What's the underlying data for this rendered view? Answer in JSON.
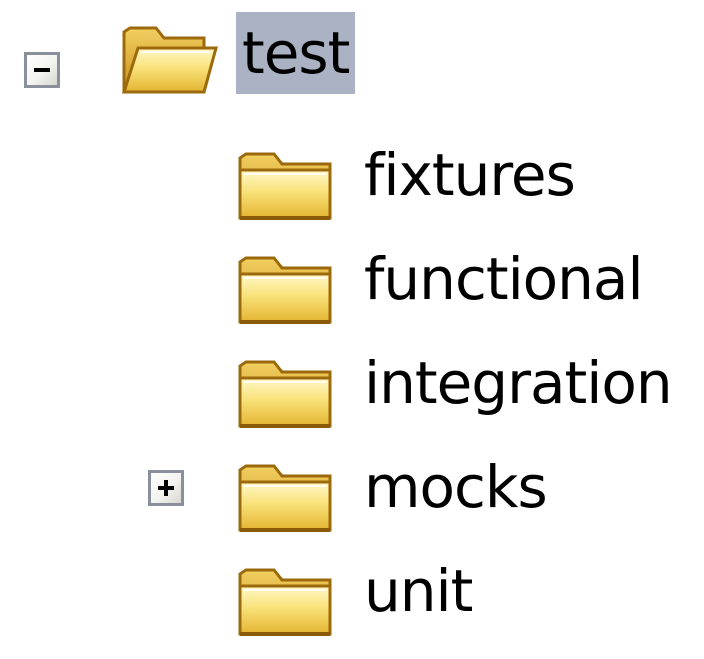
{
  "tree": {
    "root": {
      "label": "test",
      "expander": "collapse",
      "selected": true,
      "icon": "folder-icon"
    },
    "children": [
      {
        "label": "fixtures",
        "icon": "folder-icon",
        "expander": null
      },
      {
        "label": "functional",
        "icon": "folder-icon",
        "expander": null
      },
      {
        "label": "integration",
        "icon": "folder-icon",
        "expander": null
      },
      {
        "label": "mocks",
        "icon": "folder-icon",
        "expander": "expand"
      },
      {
        "label": "unit",
        "icon": "folder-icon",
        "expander": null
      }
    ]
  },
  "colors": {
    "selection": "#aab2c4",
    "folder_front": "#f7dc6a",
    "folder_outline": "#b07d12"
  }
}
